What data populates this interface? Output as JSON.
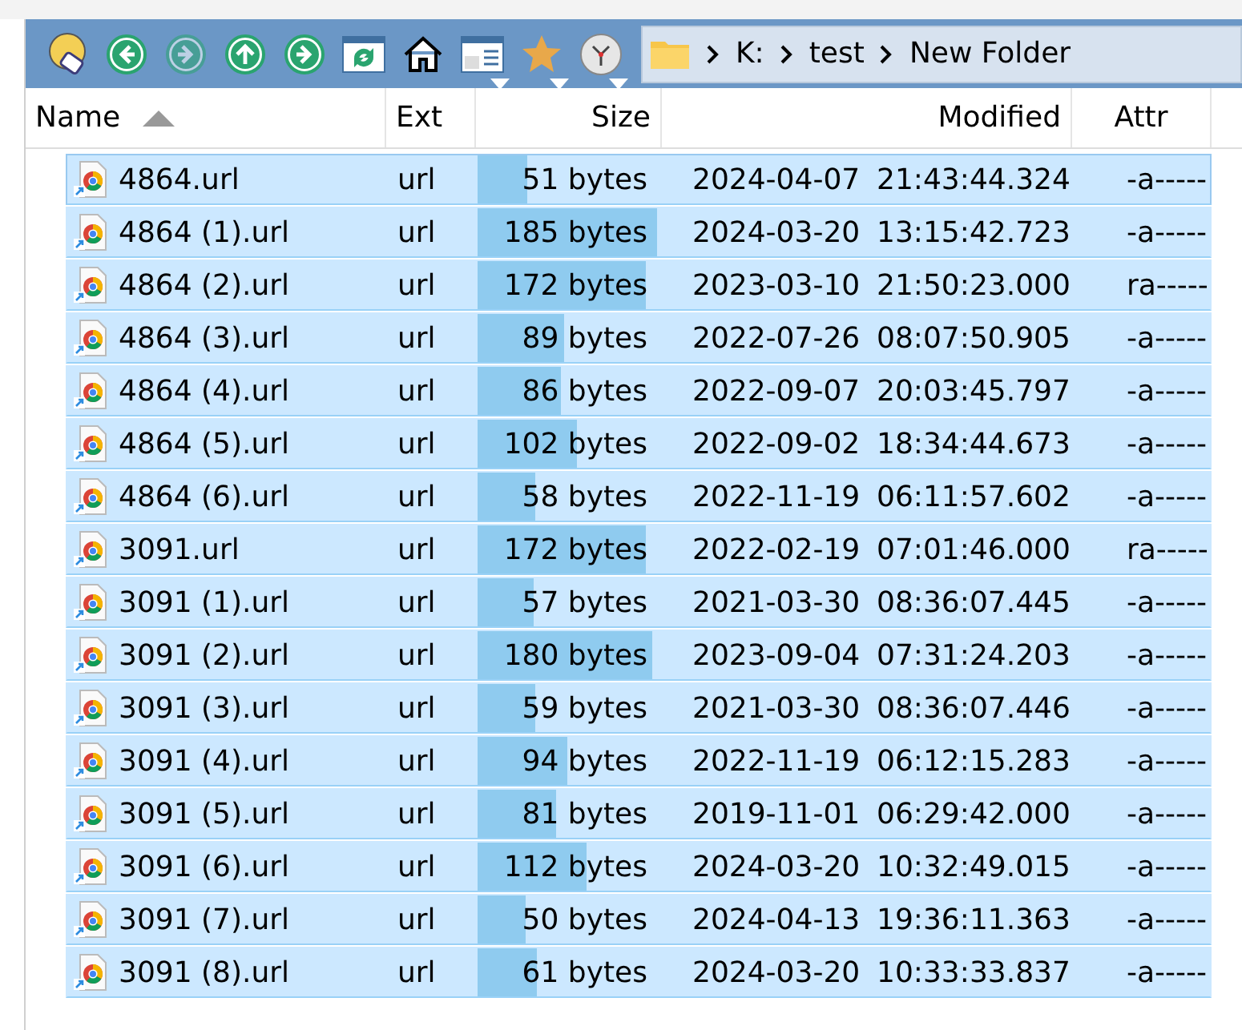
{
  "toolbar": {
    "buttons": [
      {
        "kind": "drive",
        "disabled": false,
        "dropdown": false
      },
      {
        "kind": "back",
        "disabled": false,
        "dropdown": false
      },
      {
        "kind": "forward",
        "disabled": true,
        "dropdown": false
      },
      {
        "kind": "up",
        "disabled": false,
        "dropdown": false
      },
      {
        "kind": "go",
        "disabled": false,
        "dropdown": false
      },
      {
        "kind": "refresh",
        "disabled": false,
        "dropdown": false
      },
      {
        "kind": "home",
        "disabled": false,
        "dropdown": false
      },
      {
        "kind": "view",
        "disabled": false,
        "dropdown": true
      },
      {
        "kind": "star",
        "disabled": false,
        "dropdown": true
      },
      {
        "kind": "clock",
        "disabled": false,
        "dropdown": true
      }
    ]
  },
  "address": {
    "segments": [
      "K:",
      "test",
      "New Folder"
    ]
  },
  "table": {
    "columns": [
      {
        "label": "Name",
        "sorted": true
      },
      {
        "label": "Ext",
        "sorted": false
      },
      {
        "label": "Size",
        "sorted": false
      },
      {
        "label": "Modified",
        "sorted": false
      },
      {
        "label": "Attr",
        "sorted": false
      }
    ],
    "rows": [
      {
        "name": "4864.url",
        "ext": "url",
        "size": "51 bytes",
        "level": 0.27,
        "date": "2024-04-07",
        "time": "21:43:44.324",
        "attr": "-a-----",
        "selected": true,
        "focused": true
      },
      {
        "name": "4864 (1).url",
        "ext": "url",
        "size": "185 bytes",
        "level": 0.97,
        "date": "2024-03-20",
        "time": "13:15:42.723",
        "attr": "-a-----",
        "selected": true,
        "focused": false
      },
      {
        "name": "4864 (2).url",
        "ext": "url",
        "size": "172 bytes",
        "level": 0.91,
        "date": "2023-03-10",
        "time": "21:50:23.000",
        "attr": "ra-----",
        "selected": true,
        "focused": false
      },
      {
        "name": "4864 (3).url",
        "ext": "url",
        "size": "89 bytes",
        "level": 0.47,
        "date": "2022-07-26",
        "time": "08:07:50.905",
        "attr": "-a-----",
        "selected": true,
        "focused": false
      },
      {
        "name": "4864 (4).url",
        "ext": "url",
        "size": "86 bytes",
        "level": 0.45,
        "date": "2022-09-07",
        "time": "20:03:45.797",
        "attr": "-a-----",
        "selected": true,
        "focused": false
      },
      {
        "name": "4864 (5).url",
        "ext": "url",
        "size": "102 bytes",
        "level": 0.54,
        "date": "2022-09-02",
        "time": "18:34:44.673",
        "attr": "-a-----",
        "selected": true,
        "focused": false
      },
      {
        "name": "4864 (6).url",
        "ext": "url",
        "size": "58 bytes",
        "level": 0.31,
        "date": "2022-11-19",
        "time": "06:11:57.602",
        "attr": "-a-----",
        "selected": true,
        "focused": false
      },
      {
        "name": "3091.url",
        "ext": "url",
        "size": "172 bytes",
        "level": 0.91,
        "date": "2022-02-19",
        "time": "07:01:46.000",
        "attr": "ra-----",
        "selected": true,
        "focused": false
      },
      {
        "name": "3091 (1).url",
        "ext": "url",
        "size": "57 bytes",
        "level": 0.3,
        "date": "2021-03-30",
        "time": "08:36:07.445",
        "attr": "-a-----",
        "selected": true,
        "focused": false
      },
      {
        "name": "3091 (2).url",
        "ext": "url",
        "size": "180 bytes",
        "level": 0.95,
        "date": "2023-09-04",
        "time": "07:31:24.203",
        "attr": "-a-----",
        "selected": true,
        "focused": false
      },
      {
        "name": "3091 (3).url",
        "ext": "url",
        "size": "59 bytes",
        "level": 0.31,
        "date": "2021-03-30",
        "time": "08:36:07.446",
        "attr": "-a-----",
        "selected": true,
        "focused": false
      },
      {
        "name": "3091 (4).url",
        "ext": "url",
        "size": "94 bytes",
        "level": 0.49,
        "date": "2022-11-19",
        "time": "06:12:15.283",
        "attr": "-a-----",
        "selected": true,
        "focused": false
      },
      {
        "name": "3091 (5).url",
        "ext": "url",
        "size": "81 bytes",
        "level": 0.43,
        "date": "2019-11-01",
        "time": "06:29:42.000",
        "attr": "-a-----",
        "selected": true,
        "focused": false
      },
      {
        "name": "3091 (6).url",
        "ext": "url",
        "size": "112 bytes",
        "level": 0.59,
        "date": "2024-03-20",
        "time": "10:32:49.015",
        "attr": "-a-----",
        "selected": true,
        "focused": false
      },
      {
        "name": "3091 (7).url",
        "ext": "url",
        "size": "50 bytes",
        "level": 0.26,
        "date": "2024-04-13",
        "time": "19:36:11.363",
        "attr": "-a-----",
        "selected": true,
        "focused": false
      },
      {
        "name": "3091 (8).url",
        "ext": "url",
        "size": "61 bytes",
        "level": 0.32,
        "date": "2024-03-20",
        "time": "10:33:33.837",
        "attr": "-a-----",
        "selected": true,
        "focused": false
      }
    ]
  }
}
